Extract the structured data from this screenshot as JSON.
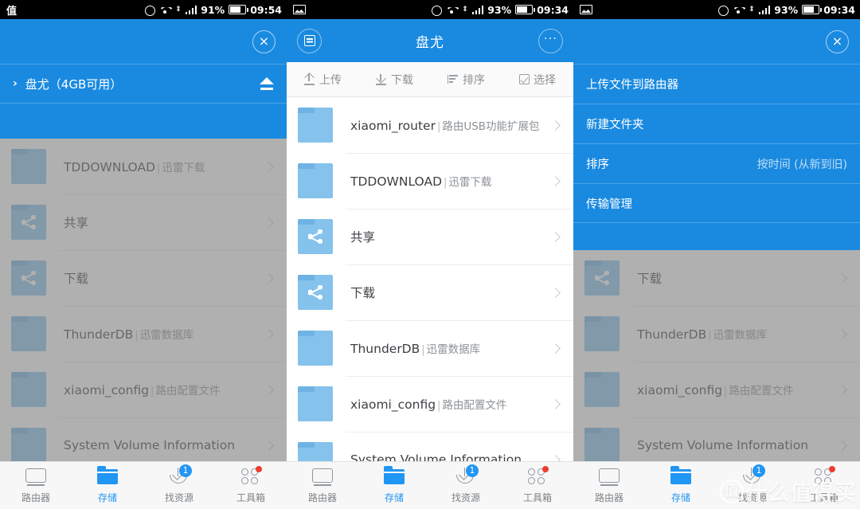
{
  "panels": [
    {
      "id": "panel-drive-selector",
      "status": {
        "left_icon": "value-char-icon",
        "left_text": "值",
        "alarm": "alarm-icon",
        "wifi": "wifi-icon",
        "signal": "signal-icon",
        "battery_pct": "91%",
        "time": "09:54"
      },
      "sheet": {
        "close": "×",
        "drive": {
          "chevron": "›",
          "label": "盘尤（4GB可用）",
          "eject_icon": "eject-icon"
        }
      },
      "files": [
        {
          "name": "TDDOWNLOAD",
          "sub": "迅雷下载",
          "type": "folder"
        },
        {
          "name": "共享",
          "sub": "",
          "type": "shared"
        },
        {
          "name": "下载",
          "sub": "",
          "type": "shared"
        },
        {
          "name": "ThunderDB",
          "sub": "迅雷数据库",
          "type": "folder"
        },
        {
          "name": "xiaomi_config",
          "sub": "路由配置文件",
          "type": "folder"
        },
        {
          "name": "System Volume Information",
          "sub": "",
          "type": "folder"
        }
      ],
      "tabs": [
        {
          "label": "路由器",
          "icon": "router-icon",
          "active": false,
          "badge": ""
        },
        {
          "label": "存储",
          "icon": "folder-icon",
          "active": true,
          "badge": ""
        },
        {
          "label": "找资源",
          "icon": "download-icon",
          "active": false,
          "badge": "1"
        },
        {
          "label": "工具箱",
          "icon": "toolbox-icon",
          "active": false,
          "badge": "dot"
        }
      ],
      "dimmed": true
    },
    {
      "id": "panel-file-browser",
      "status": {
        "left_icon": "screenshot-icon",
        "left_text": "",
        "alarm": "alarm-icon",
        "wifi": "wifi-icon",
        "signal": "signal-icon",
        "battery_pct": "93%",
        "time": "09:34"
      },
      "navbar": {
        "left_icon": "document-list-icon",
        "title": "盘尤",
        "right_icon": "more-options-icon",
        "right_glyph": "···"
      },
      "toolbar": [
        {
          "label": "上传",
          "icon": "upload-icon"
        },
        {
          "label": "下载",
          "icon": "download-icon"
        },
        {
          "label": "排序",
          "icon": "sort-icon"
        },
        {
          "label": "选择",
          "icon": "check-square-icon"
        }
      ],
      "files": [
        {
          "name": "xiaomi_router",
          "sub": "路由USB功能扩展包",
          "type": "folder"
        },
        {
          "name": "TDDOWNLOAD",
          "sub": "迅雷下载",
          "type": "folder"
        },
        {
          "name": "共享",
          "sub": "",
          "type": "shared"
        },
        {
          "name": "下载",
          "sub": "",
          "type": "shared"
        },
        {
          "name": "ThunderDB",
          "sub": "迅雷数据库",
          "type": "folder"
        },
        {
          "name": "xiaomi_config",
          "sub": "路由配置文件",
          "type": "folder"
        },
        {
          "name": "System Volume Information",
          "sub": "",
          "type": "folder"
        }
      ],
      "tabs": [
        {
          "label": "路由器",
          "icon": "router-icon",
          "active": false,
          "badge": ""
        },
        {
          "label": "存储",
          "icon": "folder-icon",
          "active": true,
          "badge": ""
        },
        {
          "label": "找资源",
          "icon": "download-icon",
          "active": false,
          "badge": "1"
        },
        {
          "label": "工具箱",
          "icon": "toolbox-icon",
          "active": false,
          "badge": "dot"
        }
      ],
      "dimmed": false
    },
    {
      "id": "panel-action-menu",
      "status": {
        "left_icon": "screenshot-icon",
        "left_text": "",
        "alarm": "alarm-icon",
        "wifi": "wifi-icon",
        "signal": "signal-icon",
        "battery_pct": "93%",
        "time": "09:34"
      },
      "sheet": {
        "close": "×",
        "items": [
          {
            "label": "上传文件到路由器",
            "value": ""
          },
          {
            "label": "新建文件夹",
            "value": ""
          },
          {
            "label": "排序",
            "value": "按时间 (从新到旧)"
          },
          {
            "label": "传输管理",
            "value": ""
          }
        ]
      },
      "files": [
        {
          "name": "下载",
          "sub": "",
          "type": "shared"
        },
        {
          "name": "ThunderDB",
          "sub": "迅雷数据库",
          "type": "folder"
        },
        {
          "name": "xiaomi_config",
          "sub": "路由配置文件",
          "type": "folder"
        },
        {
          "name": "System Volume Information",
          "sub": "",
          "type": "folder"
        }
      ],
      "tabs": [
        {
          "label": "路由器",
          "icon": "router-icon",
          "active": false,
          "badge": ""
        },
        {
          "label": "存储",
          "icon": "folder-icon",
          "active": true,
          "badge": ""
        },
        {
          "label": "找资源",
          "icon": "download-icon",
          "active": false,
          "badge": "1"
        },
        {
          "label": "工具箱",
          "icon": "toolbox-icon",
          "active": false,
          "badge": "dot"
        }
      ],
      "dimmed": true
    }
  ],
  "watermark": {
    "badge": "值",
    "text": "什么值得买"
  },
  "colors": {
    "accent_blue": "#1a8ae0",
    "tab_active": "#2196f3",
    "folder": "#85c2ec",
    "badge_red": "#f03b30"
  }
}
